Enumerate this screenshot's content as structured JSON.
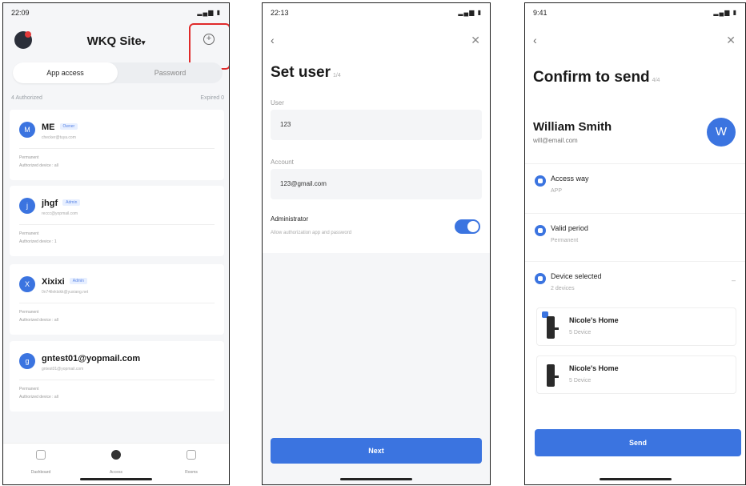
{
  "screen1": {
    "status_time": "22:09",
    "site_title": "WKQ Site",
    "tabs": [
      "App access",
      "Password"
    ],
    "authorized_count": "4 Authorized",
    "expired_count": "Expired 0",
    "users": [
      {
        "initial": "M",
        "name": "ME",
        "role": "Owner",
        "email": "checker@tuya.com",
        "validity": "Permanent",
        "devices": "Authorized device : all"
      },
      {
        "initial": "j",
        "name": "jhgf",
        "role": "Admin",
        "email": "reccc@yopmail.com",
        "validity": "Permanent",
        "devices": "Authorized device : 1"
      },
      {
        "initial": "X",
        "name": "Xixixi",
        "role": "Admin",
        "email": "0n74ilektskk@yuxiang.net",
        "validity": "Permanent",
        "devices": "Authorized device : all"
      },
      {
        "initial": "g",
        "name": "gntest01@yopmail.com",
        "role": "",
        "email": "gntest01@yopmail.com",
        "validity": "Permanent",
        "devices": "Authorized device : all"
      }
    ],
    "bottom_tabs": [
      "Dashboard",
      "Access",
      "Rooms"
    ]
  },
  "screen2": {
    "status_time": "22:13",
    "title": "Set user",
    "step": "1/4",
    "user_label": "User",
    "user_value": "123",
    "account_label": "Account",
    "account_value": "123@gmail.com",
    "admin_label": "Administrator",
    "admin_desc": "Allow authorization app and password",
    "next_label": "Next"
  },
  "screen3": {
    "status_time": "9:41",
    "title": "Confirm to send",
    "step": "4/4",
    "person_name": "William Smith",
    "person_email": "will@email.com",
    "person_initial": "W",
    "access_title": "Access way",
    "access_value": "APP",
    "period_title": "Valid period",
    "period_value": "Permanent",
    "device_title": "Device selected",
    "device_value": "2 devices",
    "devices": [
      {
        "name": "Nicole's Home",
        "count": "5 Device"
      },
      {
        "name": "Nicole's Home",
        "count": "5 Device"
      }
    ],
    "send_label": "Send"
  },
  "icons": {
    "add": "plus-circle-icon",
    "back": "chevron-left-icon",
    "close": "close-icon"
  },
  "colors": {
    "accent": "#3b74e0",
    "highlight": "#e02a2a"
  }
}
